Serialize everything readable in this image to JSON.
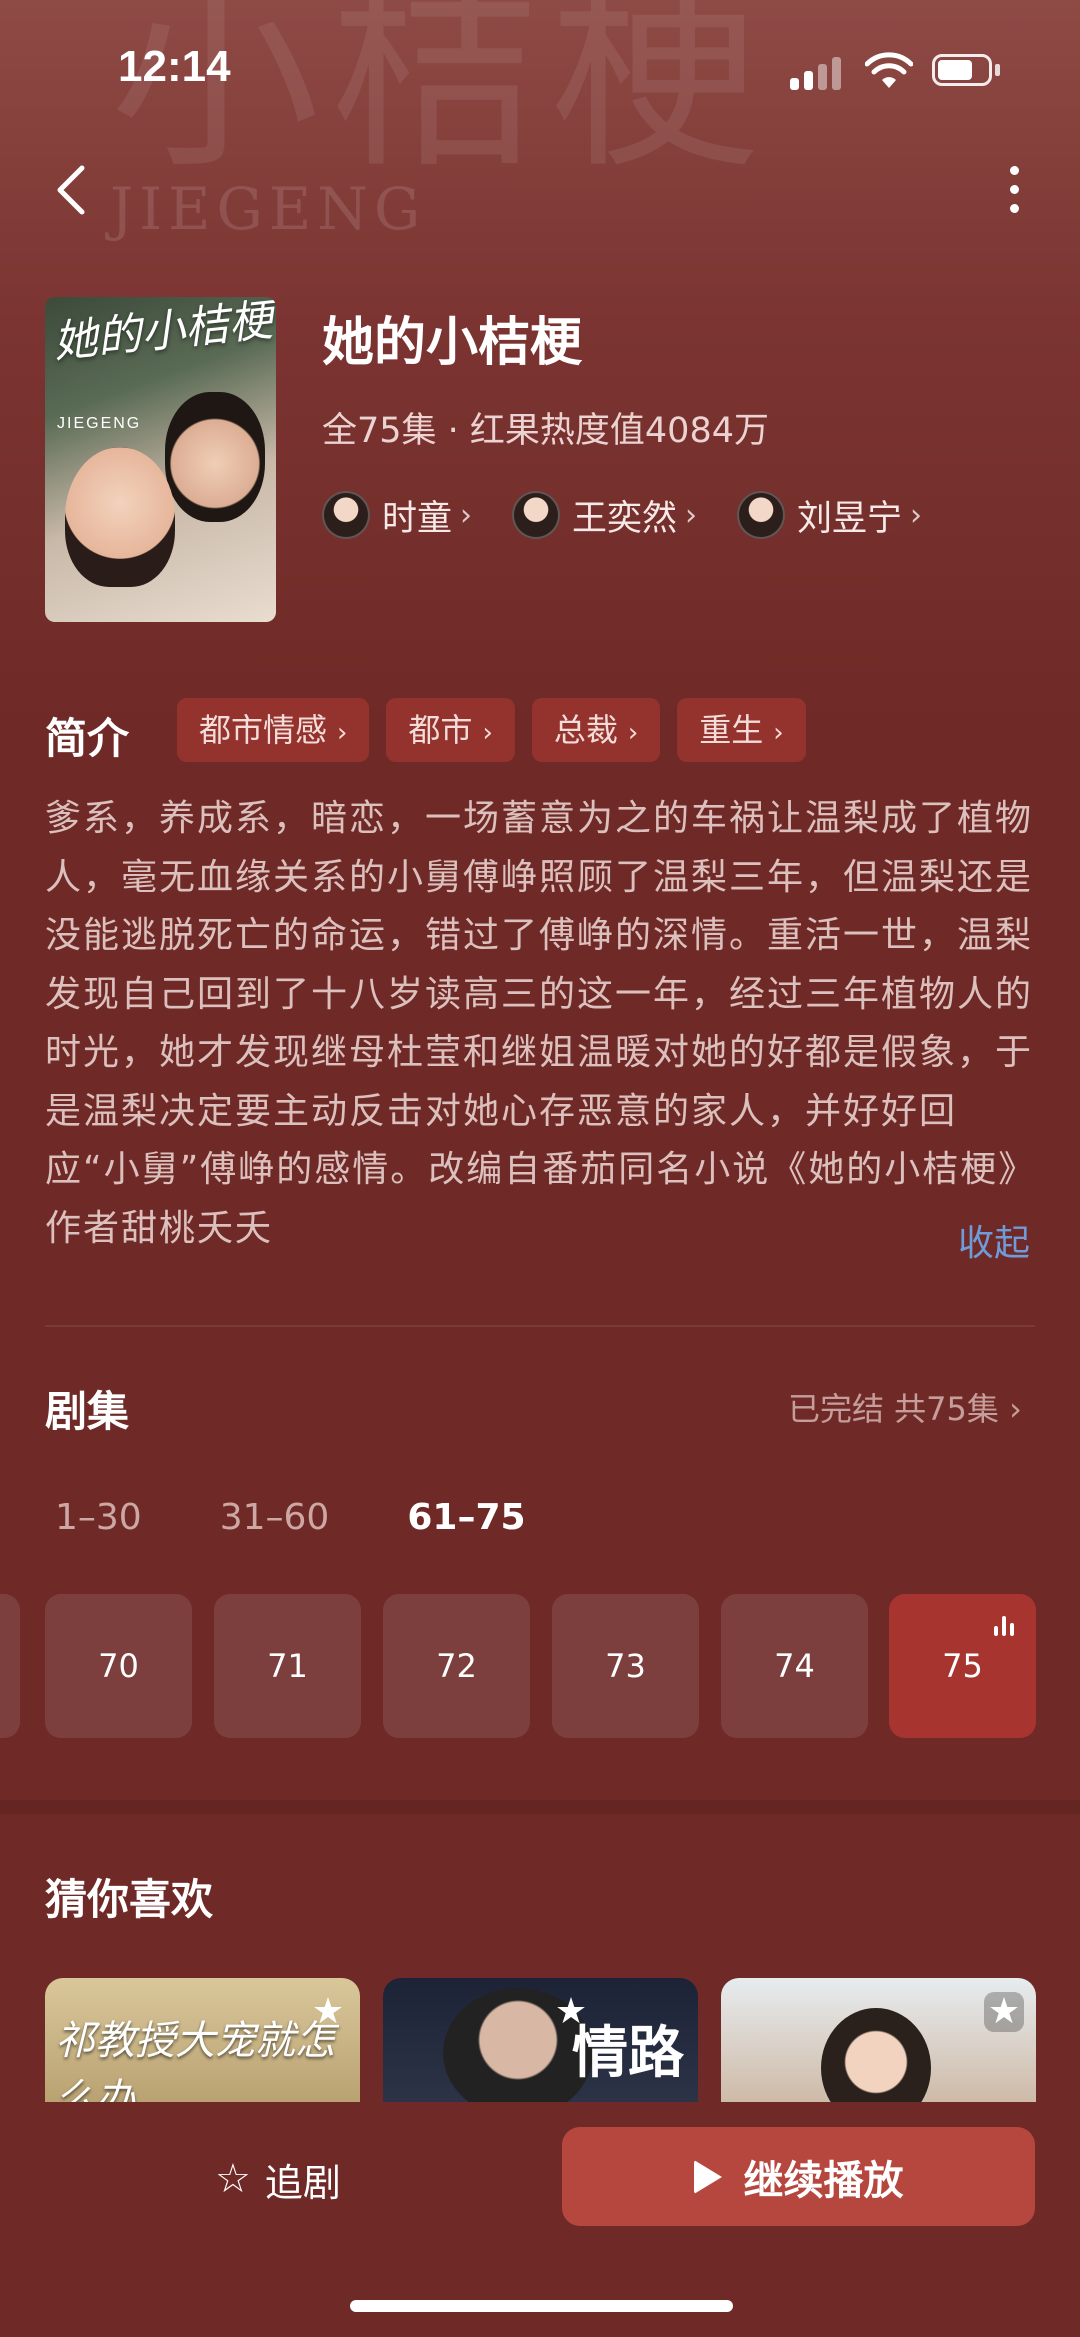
{
  "status": {
    "time": "12:14"
  },
  "header": {
    "back_icon": "chevron-left-icon",
    "more_icon": "more-vertical-icon"
  },
  "poster": {
    "title_art": "她的小桔梗",
    "subtitle_art": "JIEGENG"
  },
  "hero_bg": {
    "watermark_cn": "小桔梗",
    "watermark_en": "JIEGENG"
  },
  "show": {
    "title": "她的小桔梗",
    "meta": "全75集 · 红果热度值4084万",
    "cast": [
      {
        "name": "时童"
      },
      {
        "name": "王奕然"
      },
      {
        "name": "刘昱宁"
      }
    ]
  },
  "intro": {
    "heading": "简介",
    "tags": [
      "都市情感",
      "都市",
      "总裁",
      "重生"
    ],
    "synopsis": "爹系，养成系，暗恋，一场蓄意为之的车祸让温梨成了植物人，毫无血缘关系的小舅傅峥照顾了温梨三年，但温梨还是没能逃脱死亡的命运，错过了傅峥的深情。重活一世，温梨发现自己回到了十八岁读高三的这一年，经过三年植物人的时光，她才发现继母杜莹和继姐温暖对她的好都是假象，于是温梨决定要主动反击对她心存恶意的家人，并好好回应“小舅”傅峥的感情。改编自番茄同名小说《她的小桔梗》作者甜桃夭夭",
    "collapse": "收起"
  },
  "episodes": {
    "heading": "剧集",
    "status": "已完结 共75集",
    "ranges": [
      {
        "label": "1–30",
        "active": false
      },
      {
        "label": "31–60",
        "active": false
      },
      {
        "label": "61–75",
        "active": true
      }
    ],
    "items": [
      {
        "label": "70",
        "active": false
      },
      {
        "label": "71",
        "active": false
      },
      {
        "label": "72",
        "active": false
      },
      {
        "label": "73",
        "active": false
      },
      {
        "label": "74",
        "active": false
      },
      {
        "label": "75",
        "active": true
      }
    ]
  },
  "recommend": {
    "heading": "猜你喜欢",
    "cards": [
      {
        "art_text": "祁教授大宠就怎么办"
      },
      {
        "art_text": "情路"
      },
      {
        "art_text": ""
      }
    ]
  },
  "bottom": {
    "follow": "追剧",
    "play": "继续播放"
  },
  "colors": {
    "background": "#6f2a27",
    "accent": "#b6473f",
    "link": "#6f9bd8"
  }
}
